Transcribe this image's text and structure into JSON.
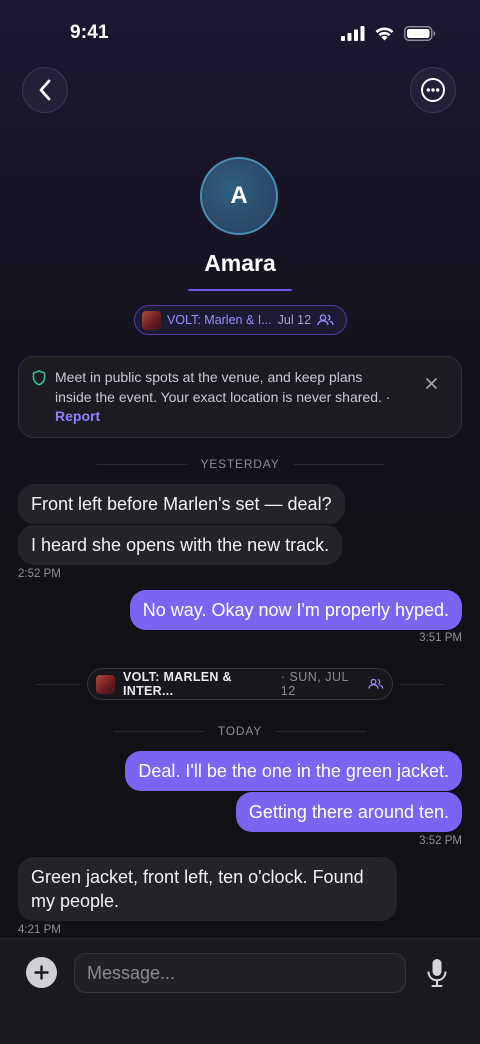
{
  "status_bar": {
    "time": "9:41"
  },
  "header": {
    "back_icon": "chevron-left-icon",
    "more_icon": "ellipsis-circle-icon"
  },
  "profile": {
    "avatar_initial": "A",
    "name": "Amara"
  },
  "event_chip": {
    "title": "VOLT: Marlen & I...",
    "date": "Jul 12"
  },
  "safety_notice": {
    "text": "Meet in public spots at the venue, and keep plans inside the event. Your exact location is never shared. · ",
    "link": "Report"
  },
  "dividers": {
    "yesterday": "YESTERDAY",
    "today": "TODAY"
  },
  "messages": [
    {
      "text": "Front left before Marlen's set — deal?"
    },
    {
      "text": "I heard she opens with the new track.",
      "time": "2:52 PM"
    },
    {
      "text": "No way. Okay now I'm properly hyped.",
      "time": "3:51 PM"
    },
    {
      "text": "Deal. I'll be the one in the green jacket."
    },
    {
      "text": "Getting there around ten.",
      "time": "3:52 PM"
    },
    {
      "text": "Green jacket, front left, ten o'clock. Found my people.",
      "time": "4:21 PM"
    }
  ],
  "event_pill": {
    "title": "VOLT: MARLEN & INTER...",
    "date": "· SUN, JUL 12"
  },
  "composer": {
    "placeholder": "Message..."
  },
  "colors": {
    "accent": "#7c63f2",
    "link": "#8f82ff",
    "shield": "#36c08b"
  }
}
